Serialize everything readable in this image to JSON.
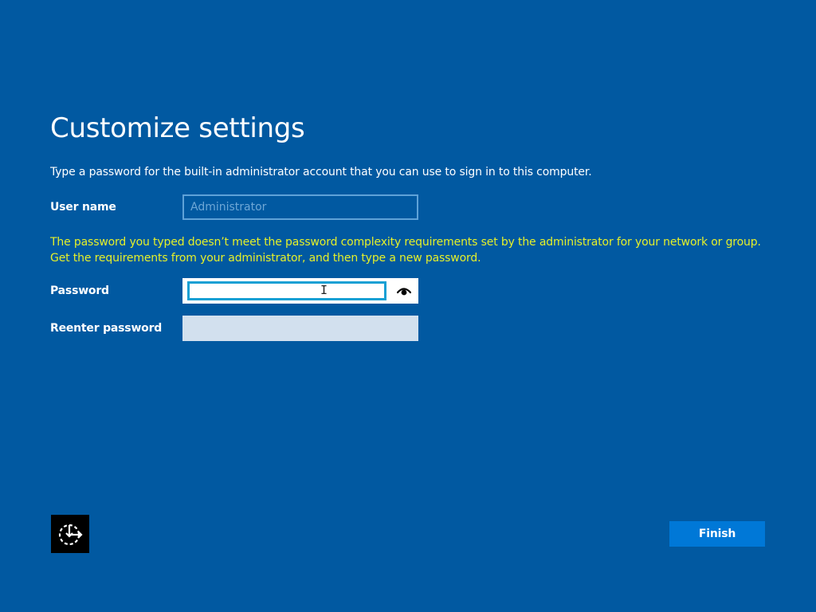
{
  "page": {
    "title": "Customize settings",
    "instruction": "Type a password for the built-in administrator account that you can use to sign in to this computer.",
    "error_message": "The password you typed doesn’t meet the password complexity requirements set by the administrator for your network or group. Get the requirements from your administrator, and then type a new password."
  },
  "fields": {
    "username": {
      "label": "User name",
      "value": "",
      "placeholder": "Administrator"
    },
    "password": {
      "label": "Password",
      "value": ""
    },
    "reenter_password": {
      "label": "Reenter password",
      "value": ""
    }
  },
  "icons": {
    "reveal_password": "eye-icon",
    "ease_of_access": "ease-of-access-icon"
  },
  "buttons": {
    "finish_label": "Finish"
  },
  "colors": {
    "background": "#0159a1",
    "error_text": "#e5f02a",
    "accent_button": "#0078d7",
    "focus_border": "#17a0d4"
  }
}
